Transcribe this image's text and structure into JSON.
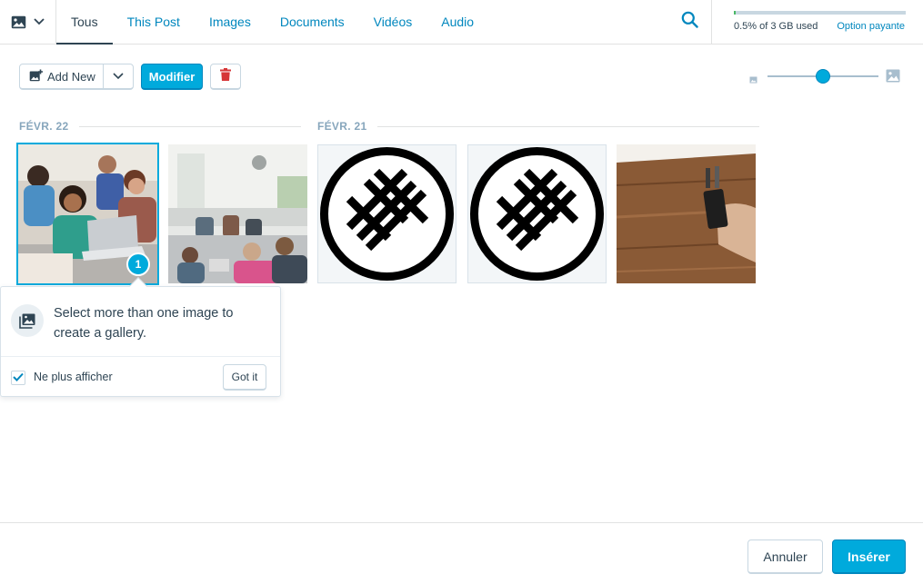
{
  "header": {
    "type_filter_icon": "image-icon",
    "tabs": [
      {
        "label": "Tous",
        "active": true
      },
      {
        "label": "This Post",
        "active": false
      },
      {
        "label": "Images",
        "active": false
      },
      {
        "label": "Documents",
        "active": false
      },
      {
        "label": "Vidéos",
        "active": false
      },
      {
        "label": "Audio",
        "active": false
      }
    ],
    "search_icon": "search-icon"
  },
  "storage": {
    "used_fraction": 0.005,
    "used_label": "0.5% of 3 GB used",
    "upgrade_link": "Option payante"
  },
  "toolbar": {
    "add_new_label": "Add New",
    "edit_label": "Modifier",
    "delete_icon": "trash-icon"
  },
  "zoom": {
    "level": 0.5
  },
  "groups": [
    {
      "date": "FÉVR. 22",
      "items": [
        {
          "kind": "photo",
          "description": "people-with-laptops",
          "selected": true,
          "selection_index": "1"
        },
        {
          "kind": "photo",
          "description": "office-workspace",
          "selected": false
        }
      ]
    },
    {
      "date": "FÉVR. 21",
      "items": [
        {
          "kind": "logo",
          "description": "circle-cross-logo",
          "selected": false
        },
        {
          "kind": "logo",
          "description": "circle-cross-logo",
          "selected": false
        },
        {
          "kind": "photo",
          "description": "wooden-table-phone",
          "selected": false
        }
      ]
    }
  ],
  "popover": {
    "message": "Select more than one image to create a gallery.",
    "checkbox_label": "Ne plus afficher",
    "checkbox_checked": true,
    "dismiss_label": "Got it"
  },
  "footer": {
    "cancel_label": "Annuler",
    "insert_label": "Insérer"
  },
  "colors": {
    "accent": "#00aadc",
    "link": "#0087be",
    "text": "#2e4453",
    "muted": "#87a6bc",
    "danger": "#d63638"
  }
}
